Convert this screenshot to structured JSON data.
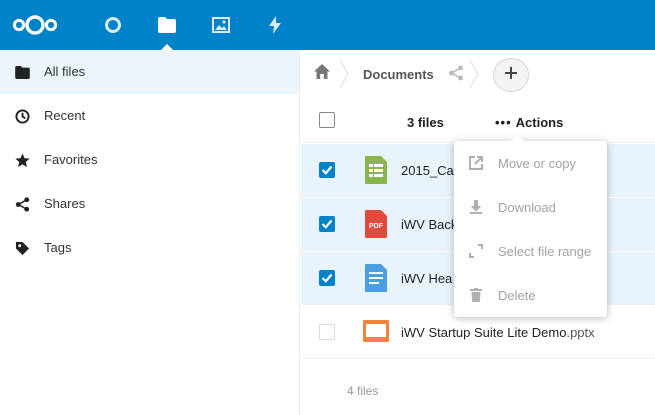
{
  "header": {
    "apps": [
      {
        "name": "dashboard",
        "icon": "circle-icon",
        "active": false
      },
      {
        "name": "files",
        "icon": "folder-icon",
        "active": true
      },
      {
        "name": "photos",
        "icon": "image-icon",
        "active": false
      },
      {
        "name": "activity",
        "icon": "lightning-icon",
        "active": false
      }
    ],
    "brand_color": "#0082c9"
  },
  "sidebar": {
    "items": [
      {
        "label": "All files",
        "icon": "folder-icon",
        "active": true
      },
      {
        "label": "Recent",
        "icon": "clock-icon",
        "active": false
      },
      {
        "label": "Favorites",
        "icon": "star-icon",
        "active": false
      },
      {
        "label": "Shares",
        "icon": "share-icon",
        "active": false
      },
      {
        "label": "Tags",
        "icon": "tag-icon",
        "active": false
      }
    ]
  },
  "breadcrumb": {
    "home_icon": "home-icon",
    "folder": "Documents",
    "share_icon": "share-icon",
    "new_icon": "plus-icon"
  },
  "list": {
    "selected_count": "3 files",
    "actions_label": "Actions",
    "files": [
      {
        "name": "2015_Ca",
        "ext": "",
        "type": "spreadsheet",
        "icon": "spreadsheet-icon",
        "selected": true
      },
      {
        "name": "iWV Back",
        "ext": "",
        "type": "pdf",
        "icon": "pdf-icon",
        "icon_text": "PDF",
        "selected": true
      },
      {
        "name": "iWV Hea",
        "ext": "",
        "type": "document",
        "icon": "document-icon",
        "selected": true
      },
      {
        "name": "iWV Startup Suite Lite Demo",
        "ext": ".pptx",
        "type": "presentation",
        "icon": "presentation-icon",
        "selected": false
      }
    ],
    "summary": "4 files"
  },
  "actions_menu": {
    "items": [
      {
        "label": "Move or copy",
        "icon": "external-link-icon"
      },
      {
        "label": "Download",
        "icon": "download-icon"
      },
      {
        "label": "Select file range",
        "icon": "select-range-icon"
      },
      {
        "label": "Delete",
        "icon": "trash-icon"
      }
    ]
  },
  "colors": {
    "selection_bg": "#e9f3fb",
    "checkbox_checked": "#0082c9",
    "spreadsheet": "#8bb54b",
    "pdf": "#e04b3f",
    "document": "#4a9fe0",
    "presentation": "#f0843c"
  }
}
